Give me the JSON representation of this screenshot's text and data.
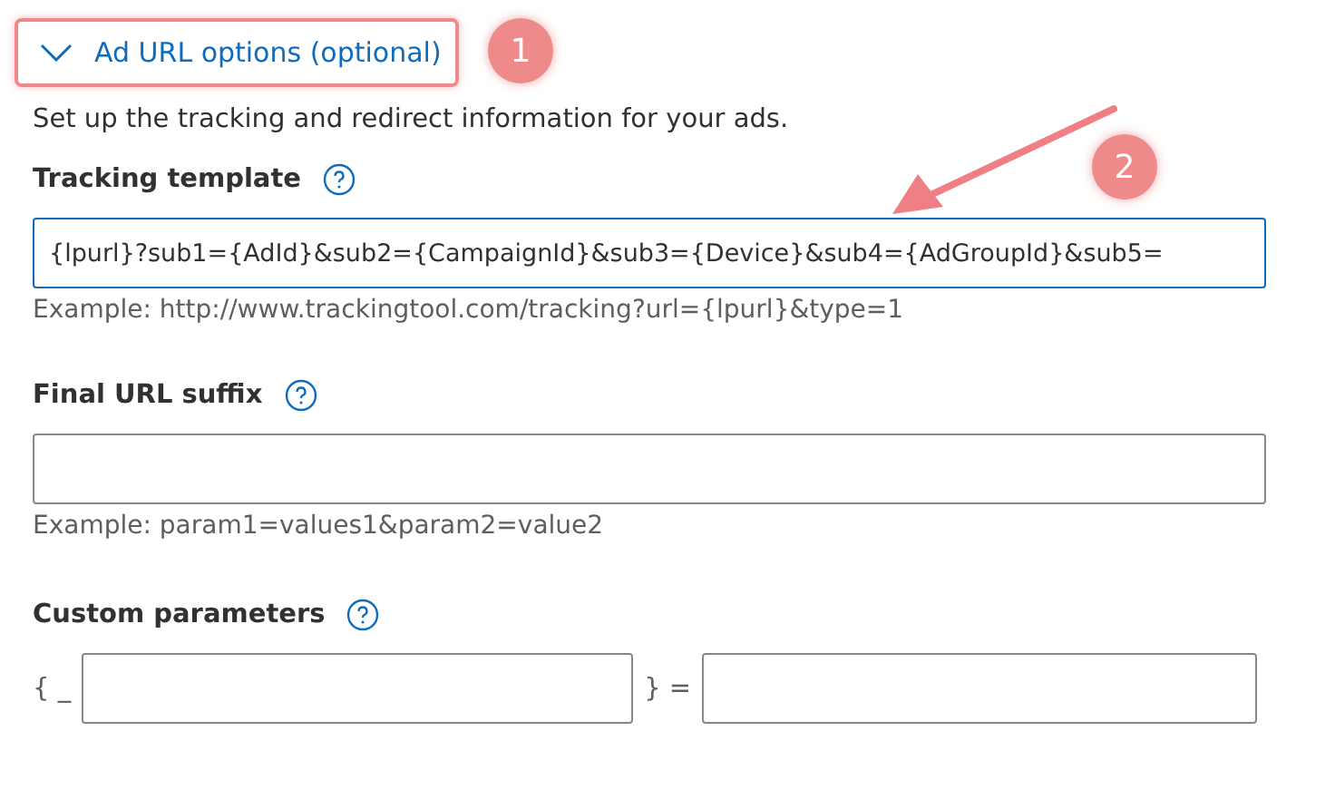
{
  "section": {
    "title": "Ad URL options (optional)",
    "expanded": true,
    "description": "Set up the tracking and redirect information for your ads."
  },
  "tracking_template": {
    "label": "Tracking template",
    "value": "{lpurl}?sub1={AdId}&sub2={CampaignId}&sub3={Device}&sub4={AdGroupId}&sub5=",
    "example": "Example: http://www.trackingtool.com/tracking?url={lpurl}&type=1"
  },
  "final_url_suffix": {
    "label": "Final URL suffix",
    "example": "Example: param1=values1&param2=value2"
  },
  "custom_parameters": {
    "label": "Custom parameters",
    "prefix": "{ _",
    "separator": "} ="
  },
  "annotations": [
    {
      "label": "1"
    },
    {
      "label": "2"
    }
  ]
}
